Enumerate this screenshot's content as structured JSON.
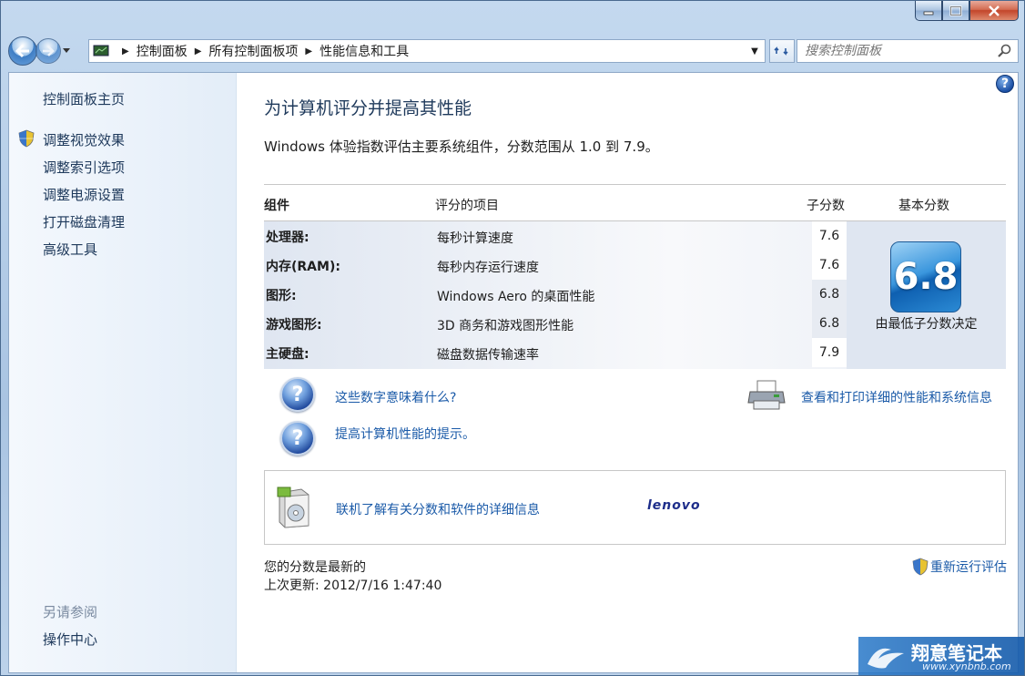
{
  "window": {
    "controls": {
      "minimize": "minimize",
      "maximize": "maximize",
      "close": "close"
    }
  },
  "navbar": {
    "breadcrumb": [
      "控制面板",
      "所有控制面板项",
      "性能信息和工具"
    ],
    "search_placeholder": "搜索控制面板"
  },
  "sidebar": {
    "home": "控制面板主页",
    "links": [
      "调整视觉效果",
      "调整索引选项",
      "调整电源设置",
      "打开磁盘清理",
      "高级工具"
    ],
    "see_also_title": "另请参阅",
    "see_also": [
      "操作中心"
    ]
  },
  "main": {
    "title": "为计算机评分并提高其性能",
    "description": "Windows 体验指数评估主要系统组件，分数范围从 1.0 到 7.9。",
    "table": {
      "headers": {
        "component": "组件",
        "rated": "评分的项目",
        "subscore": "子分数",
        "basescore": "基本分数"
      },
      "rows": [
        {
          "component": "处理器:",
          "item": "每秒计算速度",
          "score": "7.6"
        },
        {
          "component": "内存(RAM):",
          "item": "每秒内存运行速度",
          "score": "7.6"
        },
        {
          "component": "图形:",
          "item": "Windows Aero 的桌面性能",
          "score": "6.8"
        },
        {
          "component": "游戏图形:",
          "item": "3D 商务和游戏图形性能",
          "score": "6.8"
        },
        {
          "component": "主硬盘:",
          "item": "磁盘数据传输速率",
          "score": "7.9"
        }
      ],
      "base_score": "6.8",
      "base_caption": "由最低子分数决定"
    },
    "links": {
      "what_numbers": "这些数字意味着什么?",
      "tips": "提高计算机性能的提示。",
      "print_details": "查看和打印详细的性能和系统信息",
      "online_info": "联机了解有关分数和软件的详细信息"
    },
    "oem_logo": "lenovo",
    "status": {
      "current": "您的分数是最新的",
      "last_update": "上次更新: 2012/7/16 1:47:40"
    },
    "rerun": "重新运行评估"
  },
  "watermark": {
    "title": "翔意笔记本",
    "url": "www.xynbnb.com"
  }
}
